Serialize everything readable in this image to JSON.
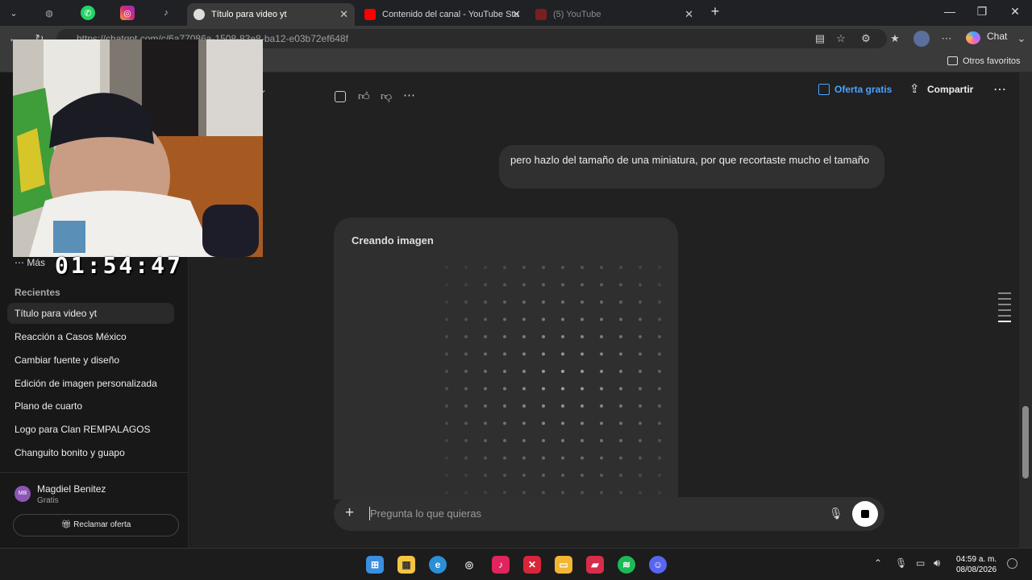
{
  "browser": {
    "tabs": [
      {
        "label": "Título para video yt",
        "active": true
      },
      {
        "label": "Contenido del canal - YouTube Stu",
        "active": false
      },
      {
        "label": "(5) YouTube",
        "active": false
      }
    ],
    "url": "https://chatgpt.com/c/6a77086a-1508-83e8-ba12-e03b72ef648f",
    "chat_label": "Chat",
    "favorites_label": "Otros favoritos"
  },
  "header": {
    "offer_label": "Oferta gratis",
    "share_label": "Compartir"
  },
  "overlay": {
    "timer": "01:54:47"
  },
  "sidebar": {
    "more_label": "Más",
    "recent_heading": "Recientes",
    "items": [
      {
        "label": "Título para video yt"
      },
      {
        "label": "Reacción a Casos México"
      },
      {
        "label": "Cambiar fuente y diseño"
      },
      {
        "label": "Edición de imagen personalizada"
      },
      {
        "label": "Plano de cuarto"
      },
      {
        "label": "Logo para Clan REMPALAGOS"
      },
      {
        "label": "Changuito bonito y guapo"
      }
    ],
    "user": {
      "initials": "MB",
      "name": "Magdiel Benitez",
      "plan": "Gratis"
    },
    "claim_label": "Reclamar oferta"
  },
  "chat": {
    "user_message": "pero hazlo del tamaño de una miniatura, por que recortaste mucho el tamaño",
    "image_status": "Creando imagen",
    "composer_placeholder": "Pregunta lo que quieras"
  },
  "taskbar": {
    "time": "04:59 a. m.",
    "date": "08/08/2026"
  },
  "colors": {
    "accent_blue": "#4aa3ff",
    "sidebar_bg": "#181818",
    "main_bg": "#212121",
    "bubble_bg": "#303030"
  }
}
